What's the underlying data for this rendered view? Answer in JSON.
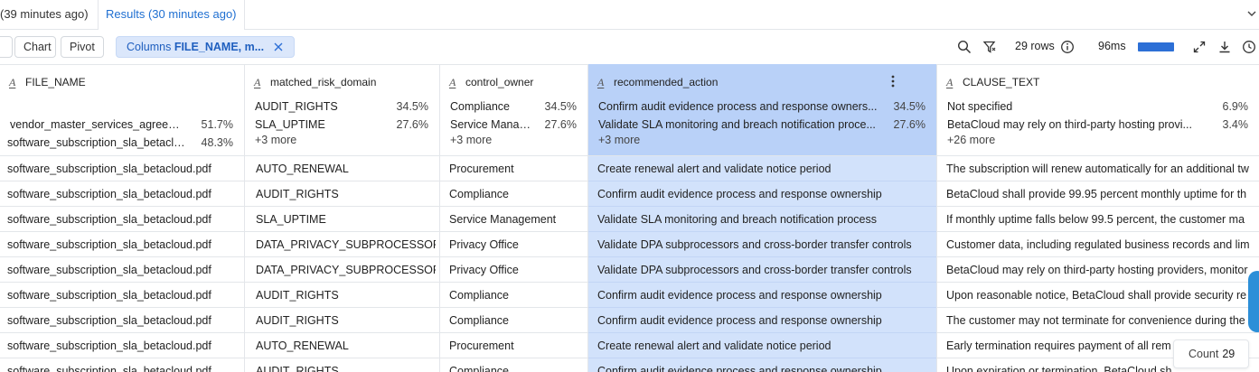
{
  "tabs": {
    "previous": "(39 minutes ago)",
    "active": "Results (30 minutes ago)"
  },
  "toolbar": {
    "chart_label": "Chart",
    "pivot_label": "Pivot",
    "columns_prefix": "Columns",
    "columns_value": "FILE_NAME, m...",
    "rows_label": "29 rows",
    "duration_label": "96ms",
    "accent_color": "#2c6fd6"
  },
  "columns": [
    {
      "name": "FILE_NAME",
      "stats": [
        {
          "value": "vendor_master_services_agreeme...",
          "pct": "51.7%"
        },
        {
          "value": "software_subscription_sla_betaclo...",
          "pct": "48.3%"
        }
      ],
      "more": ""
    },
    {
      "name": "matched_risk_domain",
      "stats": [
        {
          "value": "AUDIT_RIGHTS",
          "pct": "34.5%"
        },
        {
          "value": "SLA_UPTIME",
          "pct": "27.6%"
        }
      ],
      "more": "+3 more"
    },
    {
      "name": "control_owner",
      "stats": [
        {
          "value": "Compliance",
          "pct": "34.5%"
        },
        {
          "value": "Service Manag...",
          "pct": "27.6%"
        }
      ],
      "more": "+3 more"
    },
    {
      "name": "recommended_action",
      "stats": [
        {
          "value": "Confirm audit evidence process and response owners...",
          "pct": "34.5%"
        },
        {
          "value": "Validate SLA monitoring and breach notification proce...",
          "pct": "27.6%"
        }
      ],
      "more": "+3 more"
    },
    {
      "name": "CLAUSE_TEXT",
      "stats": [
        {
          "value": "Not specified",
          "pct": "6.9%"
        },
        {
          "value": "BetaCloud may rely on third-party hosting provi...",
          "pct": "3.4%"
        }
      ],
      "more": "+26 more"
    }
  ],
  "rows": [
    [
      "software_subscription_sla_betacloud.pdf",
      "AUTO_RENEWAL",
      "Procurement",
      "Create renewal alert and validate notice period",
      "The subscription will renew automatically for an additional tw"
    ],
    [
      "software_subscription_sla_betacloud.pdf",
      "AUDIT_RIGHTS",
      "Compliance",
      "Confirm audit evidence process and response ownership",
      "BetaCloud shall provide 99.95 percent monthly uptime for th"
    ],
    [
      "software_subscription_sla_betacloud.pdf",
      "SLA_UPTIME",
      "Service Management",
      "Validate SLA monitoring and breach notification process",
      "If monthly uptime falls below 99.5 percent, the customer ma"
    ],
    [
      "software_subscription_sla_betacloud.pdf",
      "DATA_PRIVACY_SUBPROCESSOR",
      "Privacy Office",
      "Validate DPA subprocessors and cross-border transfer controls",
      "Customer data, including regulated business records and lim"
    ],
    [
      "software_subscription_sla_betacloud.pdf",
      "DATA_PRIVACY_SUBPROCESSOR",
      "Privacy Office",
      "Validate DPA subprocessors and cross-border transfer controls",
      "BetaCloud may rely on third-party hosting providers, monitor"
    ],
    [
      "software_subscription_sla_betacloud.pdf",
      "AUDIT_RIGHTS",
      "Compliance",
      "Confirm audit evidence process and response ownership",
      "Upon reasonable notice, BetaCloud shall provide security re"
    ],
    [
      "software_subscription_sla_betacloud.pdf",
      "AUDIT_RIGHTS",
      "Compliance",
      "Confirm audit evidence process and response ownership",
      "The customer may not terminate for convenience during the"
    ],
    [
      "software_subscription_sla_betacloud.pdf",
      "AUTO_RENEWAL",
      "Procurement",
      "Create renewal alert and validate notice period",
      "Early termination requires payment of all rem"
    ],
    [
      "software_subscription_sla_betacloud.pdf",
      "AUDIT_RIGHTS",
      "Compliance",
      "Confirm audit evidence process and response ownership",
      "Upon expiration or termination, BetaCloud sh"
    ]
  ],
  "count_box": {
    "label": "Count",
    "value": "29"
  }
}
